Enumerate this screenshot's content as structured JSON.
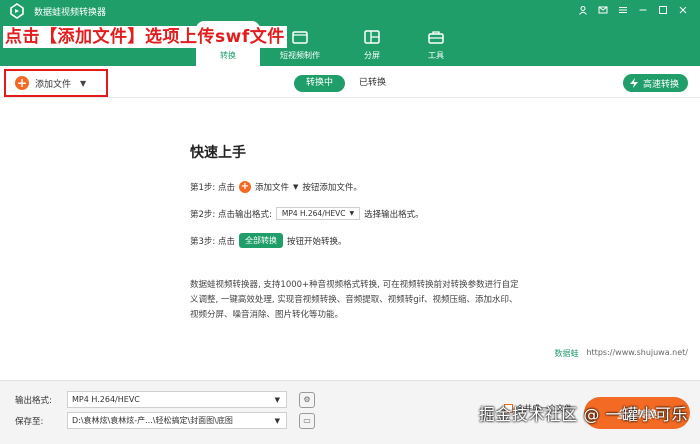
{
  "app": {
    "title": "数据蛙视频转换器"
  },
  "overlay_title": "点击【添加文件】选项上传swf文件",
  "tabs": [
    {
      "label": "转换",
      "icon": "convert-icon",
      "active": true
    },
    {
      "label": "短视频制作",
      "icon": "video-maker-icon",
      "active": false
    },
    {
      "label": "分屏",
      "icon": "split-screen-icon",
      "active": false
    },
    {
      "label": "工具",
      "icon": "toolbox-icon",
      "active": false
    }
  ],
  "toolbar": {
    "add_file": "添加文件",
    "status_converting": "转换中",
    "status_converted": "已转换",
    "fast_convert": "高速转换"
  },
  "quick_start": {
    "title": "快速上手",
    "step1": {
      "prefix": "第1步: 点击",
      "button": "添加文件",
      "suffix": "按钮添加文件。"
    },
    "step2": {
      "prefix": "第2步: 点击输出格式:",
      "format": "MP4 H.264/HEVC",
      "suffix": "选择输出格式。"
    },
    "step3": {
      "prefix": "第3步: 点击",
      "button": "全部转换",
      "suffix": "按钮开始转换。"
    },
    "description": "数据蛙视频转换器, 支持1000+种音视频格式转换, 可在视频转换前对转换参数进行自定义调整, 一键高效处理, 实现音视频转换、音频提取、视频转gif、视频压缩、添加水印、视频分屏、噪音消除、图片转化等功能。",
    "site_brand": "数据蛙",
    "site_url": "https://www.shujuwa.net/"
  },
  "bottom": {
    "output_format_label": "输出格式:",
    "output_format_value": "MP4 H.264/HEVC",
    "save_to_label": "保存至:",
    "save_to_value": "D:\\袁林炫\\袁林炫-产...\\轻松搞定\\封面图\\底图",
    "merge_label": "合并成一个文件",
    "convert_all": "全部转换"
  },
  "watermark": "掘金技术社区 @ 一罐小可乐",
  "colors": {
    "brand_green": "#1f9e6a",
    "accent_orange": "#f26a23",
    "highlight_red": "#e51b1b"
  }
}
